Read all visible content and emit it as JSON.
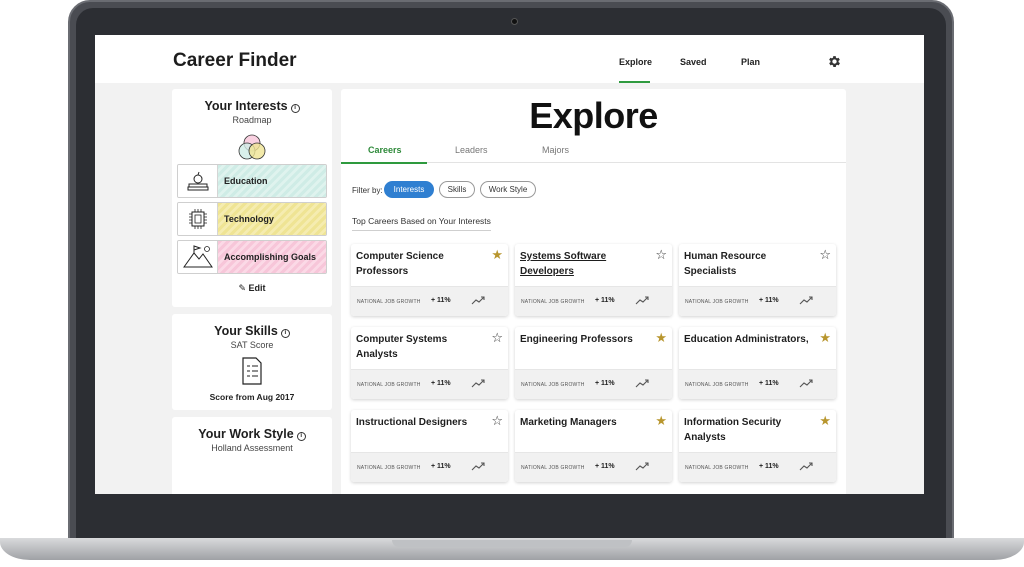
{
  "app": {
    "title": "Career Finder"
  },
  "nav": {
    "items": [
      "Explore",
      "Saved",
      "Plan"
    ],
    "active": "Explore"
  },
  "sidebar": {
    "interests": {
      "title": "Your Interests",
      "subtitle": "Roadmap",
      "items": [
        {
          "label": "Education",
          "icon": "apple-books-icon",
          "color": "#cfece6"
        },
        {
          "label": "Technology",
          "icon": "chip-icon",
          "color": "#efe494"
        },
        {
          "label": "Accomplishing Goals",
          "icon": "mountain-flag-icon",
          "color": "#f7c6d9"
        }
      ],
      "edit_label": "Edit"
    },
    "skills": {
      "title": "Your Skills",
      "subtitle": "SAT Score",
      "note": "Score from Aug 2017"
    },
    "workstyle": {
      "title": "Your Work Style",
      "subtitle": "Holland Assessment"
    }
  },
  "main": {
    "title": "Explore",
    "tabs": [
      "Careers",
      "Leaders",
      "Majors"
    ],
    "active_tab": "Careers",
    "filter_label": "Filter by:",
    "filters": [
      {
        "label": "Interests",
        "active": true
      },
      {
        "label": "Skills",
        "active": false
      },
      {
        "label": "Work Style",
        "active": false
      }
    ],
    "section_label": "Top Careers Based on Your Interests",
    "growth_label": "NATIONAL JOB GROWTH",
    "careers": [
      {
        "title": "Computer Science Professors",
        "starred": true,
        "growth": "+ 11%"
      },
      {
        "title": "Systems Software Developers",
        "starred": false,
        "growth": "+ 11%"
      },
      {
        "title": "Human Resource Specialists",
        "starred": false,
        "growth": "+ 11%"
      },
      {
        "title": "Computer Systems Analysts",
        "starred": false,
        "growth": "+ 11%"
      },
      {
        "title": "Engineering Professors",
        "starred": true,
        "growth": "+ 11%"
      },
      {
        "title": "Education Administrators,",
        "starred": true,
        "growth": "+ 11%"
      },
      {
        "title": "Instructional Designers",
        "starred": false,
        "growth": "+ 11%"
      },
      {
        "title": "Marketing Managers",
        "starred": true,
        "growth": "+ 11%"
      },
      {
        "title": "Information Security Analysts",
        "starred": true,
        "growth": "+ 11%"
      }
    ]
  },
  "colors": {
    "accent": "#2e9a3e",
    "chip_active": "#2f7fd1",
    "star": "#b8962e"
  }
}
